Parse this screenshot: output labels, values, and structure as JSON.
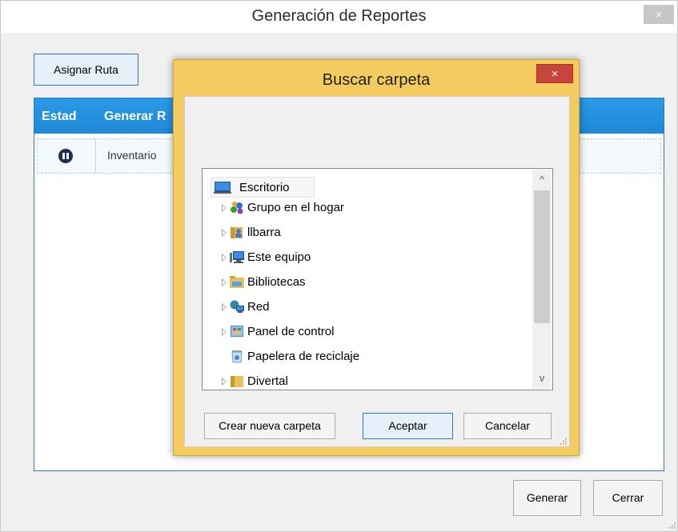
{
  "main_window": {
    "title": "Generación de Reportes",
    "close_glyph": "×",
    "assign_label": "Asignar Ruta",
    "grid": {
      "columns": [
        "Estad",
        "Generar R"
      ],
      "rows": [
        {
          "state_icon": "pause-icon",
          "name": "Inventario"
        }
      ]
    },
    "generate_label": "Generar",
    "close_label": "Cerrar"
  },
  "dialog": {
    "title": "Buscar carpeta",
    "close_glyph": "×",
    "tree": {
      "root": {
        "label": "Escritorio",
        "icon": "desktop-icon"
      },
      "items": [
        {
          "label": "Grupo en el hogar",
          "icon": "homegroup-icon",
          "expandable": true
        },
        {
          "label": "llbarra",
          "icon": "user-folder-icon",
          "expandable": true
        },
        {
          "label": "Este equipo",
          "icon": "computer-icon",
          "expandable": true
        },
        {
          "label": "Bibliotecas",
          "icon": "libraries-icon",
          "expandable": true
        },
        {
          "label": "Red",
          "icon": "network-icon",
          "expandable": true
        },
        {
          "label": "Panel de control",
          "icon": "control-panel-icon",
          "expandable": true
        },
        {
          "label": "Papelera de reciclaje",
          "icon": "recycle-bin-icon",
          "expandable": false
        },
        {
          "label": "Divertal",
          "icon": "folder-icon",
          "expandable": true
        }
      ],
      "scroll_up_glyph": "^",
      "scroll_down_glyph": "v"
    },
    "new_folder_label": "Crear nueva carpeta",
    "ok_label": "Aceptar",
    "cancel_label": "Cancelar"
  },
  "colors": {
    "accent_blue": "#2f79c8",
    "grid_header": "#1f88d6",
    "dialog_frame": "#f4cb5f",
    "dialog_close": "#c7453a"
  }
}
